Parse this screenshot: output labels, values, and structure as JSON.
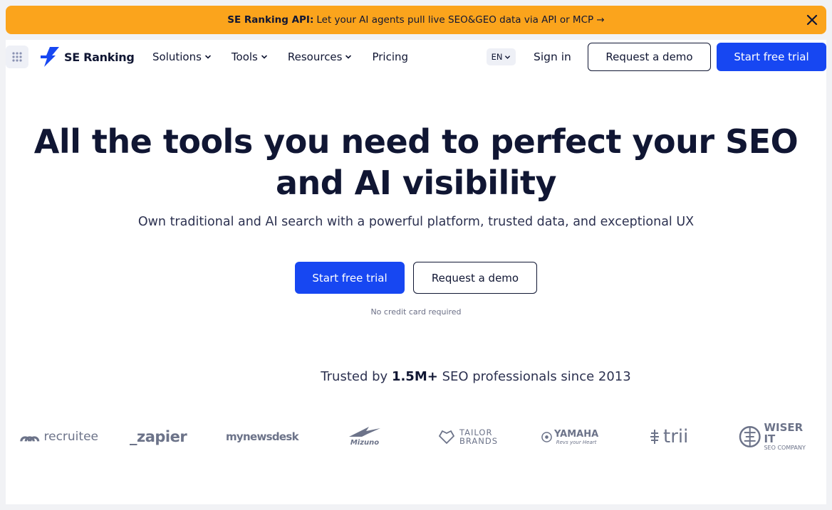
{
  "banner": {
    "strong": "SE Ranking API:",
    "text": "Let your AI agents pull live SEO&GEO data via API or MCP →"
  },
  "nav": {
    "brand": "SE Ranking",
    "menu": [
      {
        "label": "Solutions",
        "has_dropdown": true
      },
      {
        "label": "Tools",
        "has_dropdown": true
      },
      {
        "label": "Resources",
        "has_dropdown": true
      },
      {
        "label": "Pricing",
        "has_dropdown": false
      }
    ],
    "language": "EN",
    "sign_in": "Sign in",
    "request_demo": "Request a demo",
    "start_trial": "Start free trial"
  },
  "hero": {
    "title_line1": "All the tools you need to perfect your SEO",
    "title_line2": "and AI visibility",
    "subtitle": "Own traditional and AI search with a powerful platform, trusted data, and exceptional UX",
    "primary_cta": "Start free trial",
    "secondary_cta": "Request a demo",
    "note": "No credit card required"
  },
  "trusted": {
    "prefix": "Trusted by",
    "count": "1.5M+",
    "suffix": "SEO professionals since 2013"
  },
  "logos": [
    {
      "name": "recruitee"
    },
    {
      "name": "_zapier"
    },
    {
      "name": "mynewsdesk"
    },
    {
      "name": "Mizuno"
    },
    {
      "name_line1": "TAILOR",
      "name_line2": "BRANDS"
    },
    {
      "name": "YAMAHA",
      "tagline": "Revs your Heart"
    },
    {
      "name": "trii"
    },
    {
      "name_line1": "WISER IT",
      "name_line2": "SEO COMPANY"
    }
  ],
  "colors": {
    "banner": "#fba41c",
    "primary": "#1747f2",
    "text": "#101633",
    "logo_gray": "#6c7389"
  }
}
